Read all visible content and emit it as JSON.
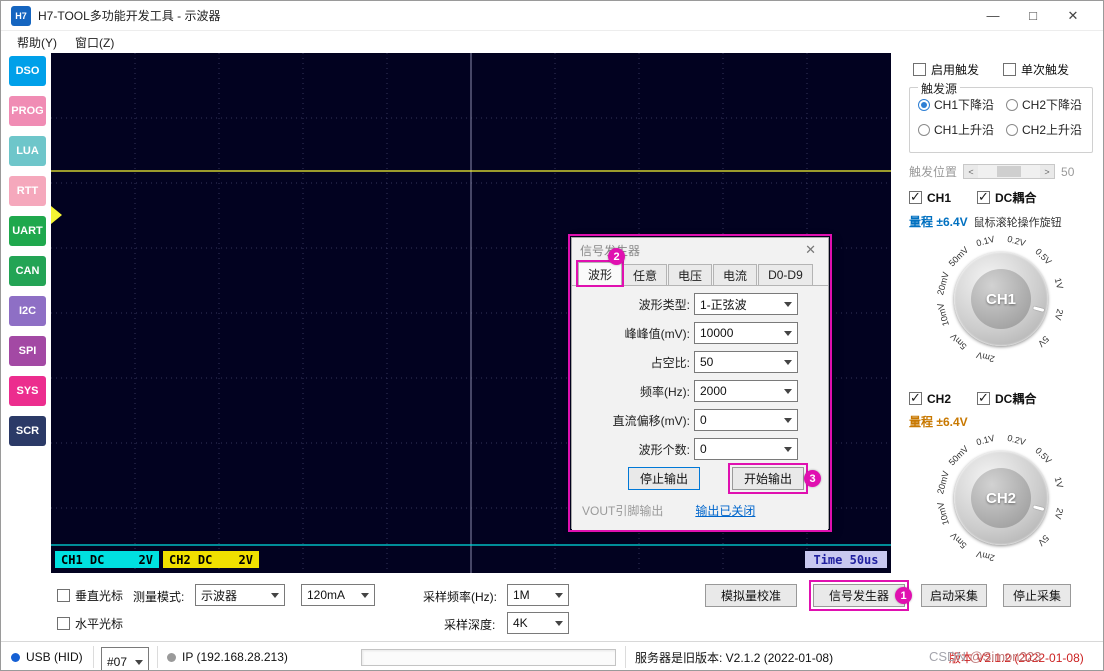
{
  "window": {
    "logo": "H7",
    "title": "H7-TOOL多功能开发工具 - 示波器",
    "minimize": "—",
    "maximize": "□",
    "close": "✕"
  },
  "menu": {
    "help": "帮助(Y)",
    "window": "窗口(Z)"
  },
  "sidebar": {
    "items": [
      {
        "label": "DSO",
        "color": "#00a0e9"
      },
      {
        "label": "PROG",
        "color": "#f08cb4"
      },
      {
        "label": "LUA",
        "color": "#6ec6ca"
      },
      {
        "label": "RTT",
        "color": "#f5a8bc"
      },
      {
        "label": "UART",
        "color": "#1fa84d"
      },
      {
        "label": "CAN",
        "color": "#23a455"
      },
      {
        "label": "I2C",
        "color": "#8e6fc5"
      },
      {
        "label": "SPI",
        "color": "#a349a4"
      },
      {
        "label": "SYS",
        "color": "#ec2d8e"
      },
      {
        "label": "SCR",
        "color": "#2b3a67"
      }
    ]
  },
  "scope": {
    "bg": "#020220",
    "ch1_label": "CH1 DC",
    "ch1_scale": "2V",
    "ch1_label_bg": "#00e0e0",
    "ch2_label": "CH2 DC",
    "ch2_scale": "2V",
    "ch2_label_bg": "#f0e000",
    "time_label": "Time 50us",
    "time_label_bg": "#c8c8f0",
    "ch1_trace_color": "#f5f533",
    "ch2_trace_color": "#00e0e0",
    "cursor_color": "#8a8aac"
  },
  "trigger": {
    "enable_label": "启用触发",
    "single_label": "单次触发",
    "source_title": "触发源",
    "sources": [
      {
        "label": "CH1下降沿",
        "selected": true
      },
      {
        "label": "CH2下降沿",
        "selected": false
      },
      {
        "label": "CH1上升沿",
        "selected": false
      },
      {
        "label": "CH2上升沿",
        "selected": false
      }
    ],
    "position_label": "触发位置",
    "position_value": "50",
    "scroll_left": "<",
    "scroll_right": ">"
  },
  "channels": {
    "hint": "鼠标滚轮操作旋钮",
    "knob_labels": [
      "2mV",
      "5mV",
      "10mV",
      "20mV",
      "50mV",
      "0.1V",
      "0.2V",
      "0.5V",
      "1V",
      "2V",
      "5V"
    ],
    "ch1": {
      "name": "CH1",
      "coupling": "DC耦合",
      "range_label": "量程",
      "range_value": "±6.4V",
      "range_color": "#0070c0",
      "knob_text": "CH1"
    },
    "ch2": {
      "name": "CH2",
      "coupling": "DC耦合",
      "range_label": "量程",
      "range_value": "±6.4V",
      "range_color": "#c87800",
      "knob_text": "CH2"
    }
  },
  "dialog": {
    "title": "信号发生器",
    "close": "✕",
    "tabs": [
      {
        "label": "波形"
      },
      {
        "label": "任意"
      },
      {
        "label": "电压"
      },
      {
        "label": "电流"
      },
      {
        "label": "D0-D9"
      }
    ],
    "fields": [
      {
        "label": "波形类型:",
        "value": "1-正弦波"
      },
      {
        "label": "峰峰值(mV):",
        "value": "10000"
      },
      {
        "label": "占空比:",
        "value": "50"
      },
      {
        "label": "频率(Hz):",
        "value": "2000"
      },
      {
        "label": "直流偏移(mV):",
        "value": "0"
      },
      {
        "label": "波形个数:",
        "value": "0"
      }
    ],
    "stop_button": "停止输出",
    "start_button": "开始输出",
    "pin_label": "VOUT引脚输出",
    "status_link": "输出已关闭"
  },
  "controls": {
    "vcursor_label": "垂直光标",
    "hcursor_label": "水平光标",
    "measure_mode_label": "测量模式:",
    "measure_mode_value": "示波器",
    "current_value": "120mA",
    "sample_rate_label": "采样频率(Hz):",
    "sample_rate_value": "1M",
    "sample_depth_label": "采样深度:",
    "sample_depth_value": "4K",
    "calibrate_button": "模拟量校准",
    "siggen_button": "信号发生器",
    "start_button": "启动采集",
    "stop_button": "停止采集"
  },
  "status": {
    "usb_label": "USB (HID)",
    "usb_dot_color": "#1560d4",
    "device_value": "#07",
    "ip_label": "IP (192.168.28.213)",
    "ip_dot_color": "#9a9a9a",
    "server_text": "服务器是旧版本: V2.1.2 (2022-01-08)",
    "version_text": "版本 V2.1.2 (2022-01-08)",
    "watermark_1": "CSDN ",
    "watermark_2": "@Simon223"
  },
  "annotations": {
    "color": "#e010b0",
    "b1": "1",
    "b2": "2",
    "b3": "3"
  }
}
